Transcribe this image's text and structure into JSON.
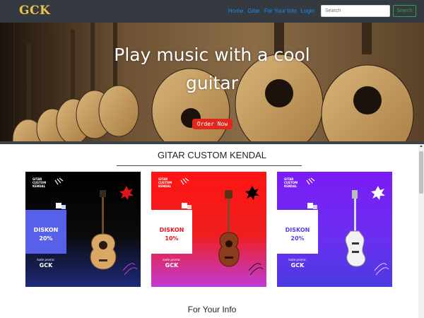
{
  "navbar": {
    "brand": "GCK",
    "links": [
      "Home",
      "Gitar",
      "For Your Info",
      "Login"
    ],
    "search_placeholder": "Search",
    "search_button": "Search"
  },
  "hero": {
    "title": "Play music with a cool guitar",
    "cta": "Order Now"
  },
  "section": {
    "title": "GITAR CUSTOM KENDAL"
  },
  "cards": [
    {
      "brand": "GITAR CUSTOM KENDAL",
      "discount_label": "DISKON",
      "discount_value": "20%",
      "promo_label": "kode promo:",
      "promo_code": "GCK",
      "guitar": "acoustic"
    },
    {
      "brand": "GITAR CUSTOM KENDAL",
      "discount_label": "DISKON",
      "discount_value": "10%",
      "promo_label": "kode promo:",
      "promo_code": "GCK",
      "guitar": "ukulele"
    },
    {
      "brand": "GITAR CUSTOM KENDAL",
      "discount_label": "DISKON",
      "discount_value": "20%",
      "promo_label": "kode promo:",
      "promo_code": "GCK",
      "guitar": "electric"
    }
  ],
  "info": {
    "title": "For Your Info"
  },
  "colors": {
    "navbar_bg": "#343a40",
    "brand": "#e9c54b",
    "link": "#1d8cf8",
    "success": "#28a745",
    "cta": "#e0281e"
  }
}
